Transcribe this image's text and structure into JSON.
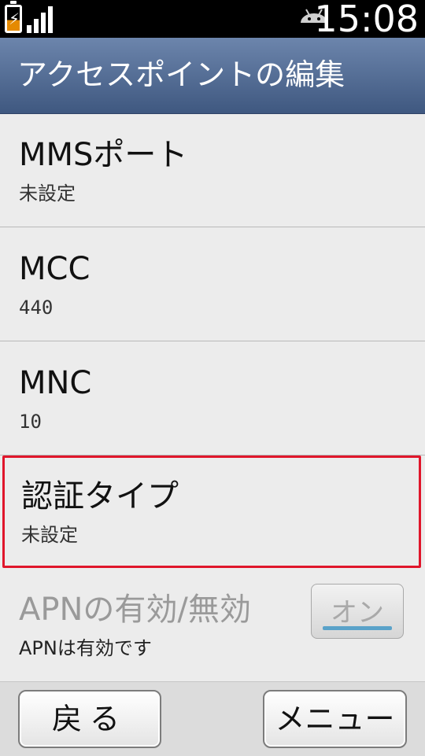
{
  "status_bar": {
    "time": "15:08",
    "icons": [
      "battery-charging-icon",
      "signal-strength-icon",
      "android-debug-icon"
    ]
  },
  "header": {
    "title": "アクセスポイントの編集"
  },
  "settings": [
    {
      "label": "MMSポート",
      "value": "未設定"
    },
    {
      "label": "MCC",
      "value": "440"
    },
    {
      "label": "MNC",
      "value": "10"
    },
    {
      "label": "認証タイプ",
      "value": "未設定"
    },
    {
      "label": "APNの有効/無効",
      "value": "APNは有効です",
      "toggle": "オン"
    }
  ],
  "bottom_bar": {
    "back_label": "戻る",
    "menu_label": "メニュー"
  },
  "colors": {
    "highlight": "#e0162b",
    "title_bar": "#4f6890",
    "toggle_accent": "#5aa2c9"
  }
}
